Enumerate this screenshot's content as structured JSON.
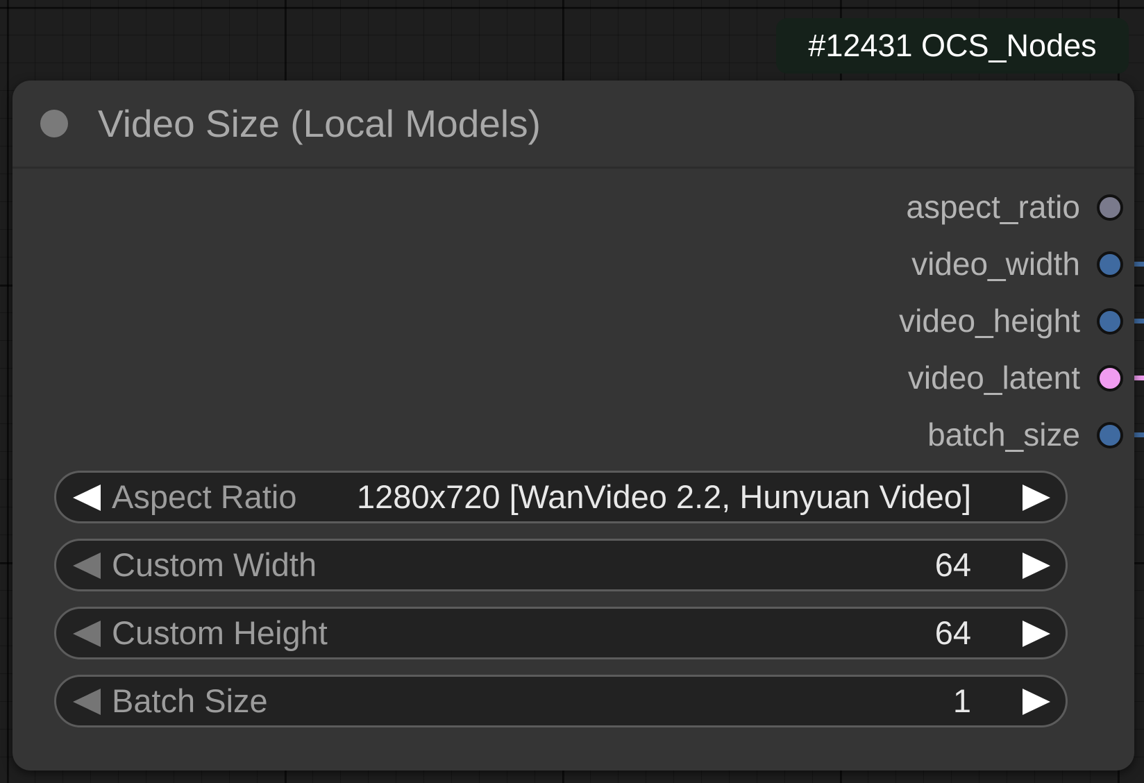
{
  "badge": {
    "text": "#12431 OCS_Nodes"
  },
  "node": {
    "title": "Video Size (Local Models)",
    "outputs": [
      {
        "label": "aspect_ratio",
        "color": "#7a7a8c"
      },
      {
        "label": "video_width",
        "color": "#3f6aa0"
      },
      {
        "label": "video_height",
        "color": "#3f6aa0"
      },
      {
        "label": "video_latent",
        "color": "#f09cf0"
      },
      {
        "label": "batch_size",
        "color": "#3f6aa0"
      }
    ],
    "widgets": [
      {
        "label": "Aspect Ratio",
        "value": "1280x720 [WanVideo 2.2, Hunyuan Video]"
      },
      {
        "label": "Custom Width",
        "value": "64"
      },
      {
        "label": "Custom Height",
        "value": "64"
      },
      {
        "label": "Batch Size",
        "value": "1"
      }
    ]
  },
  "colors": {
    "canvas_background": "#1e1e1e",
    "node_background": "#353535",
    "widget_background": "#222222",
    "badge_background": "#15211a",
    "int_link": "#3f6aa0",
    "latent_link": "#f09cf0"
  }
}
